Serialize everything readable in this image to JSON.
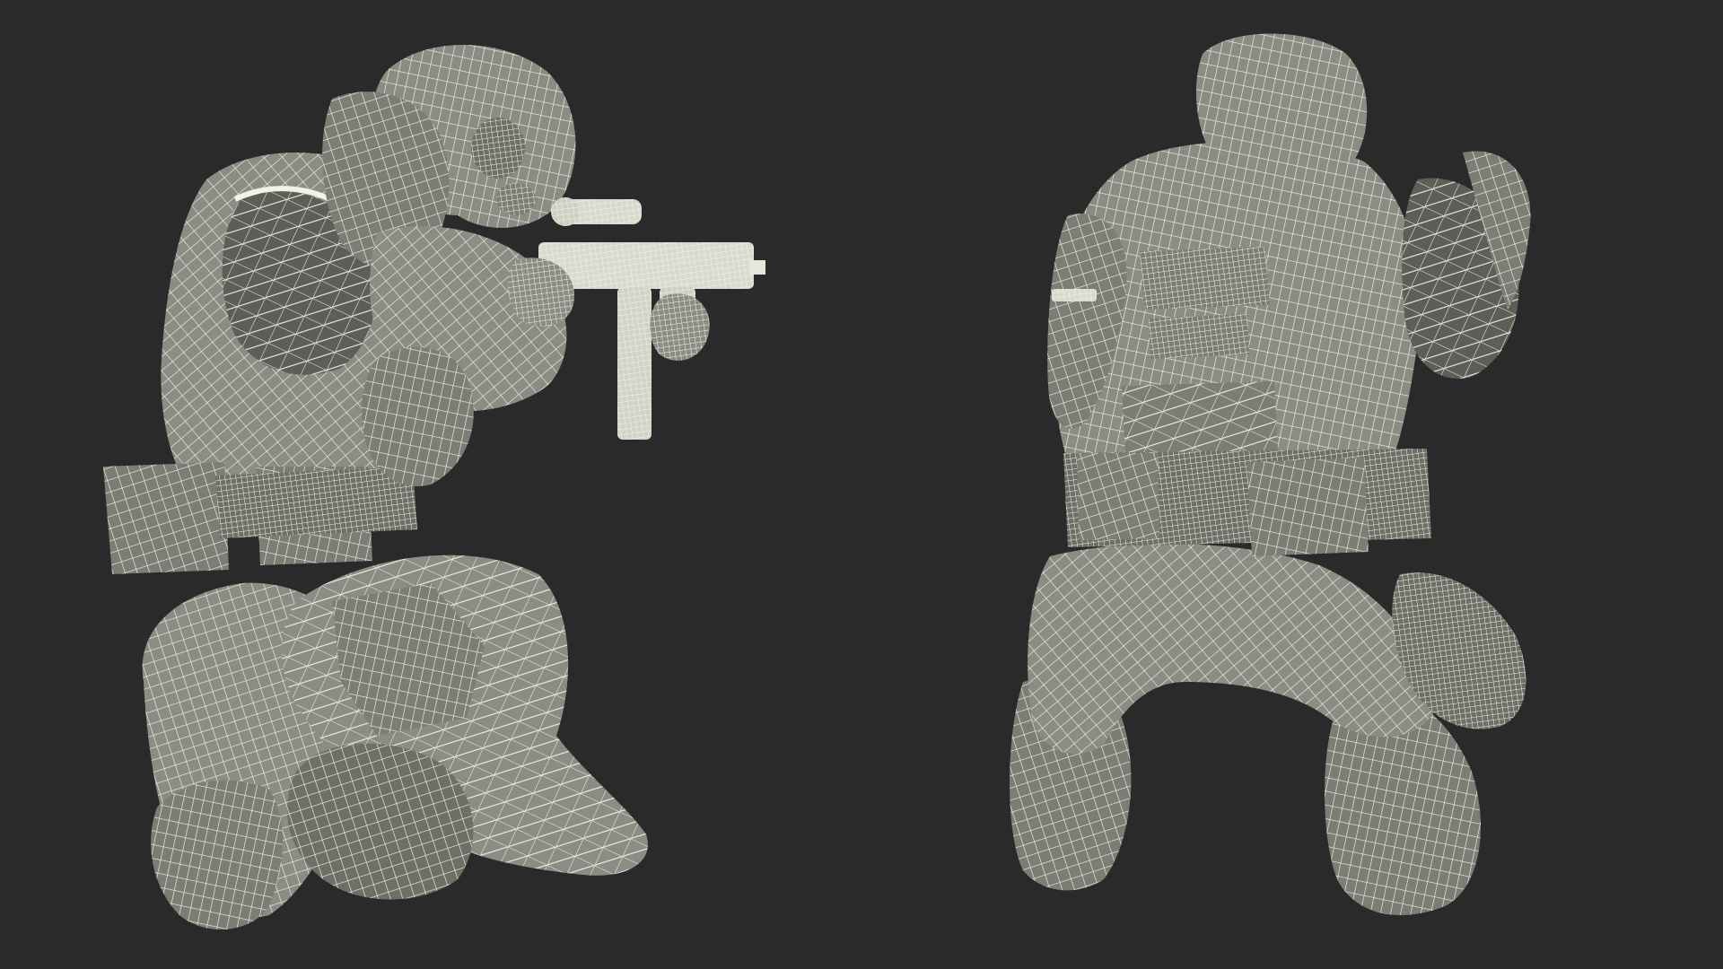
{
  "colors": {
    "background": "#2a2a2a",
    "mesh_fill": "#8c8c84",
    "mesh_fill_dark": "#6f6f68",
    "mesh_shadow": "#5e5e58",
    "wire": "#f2f2e6"
  }
}
